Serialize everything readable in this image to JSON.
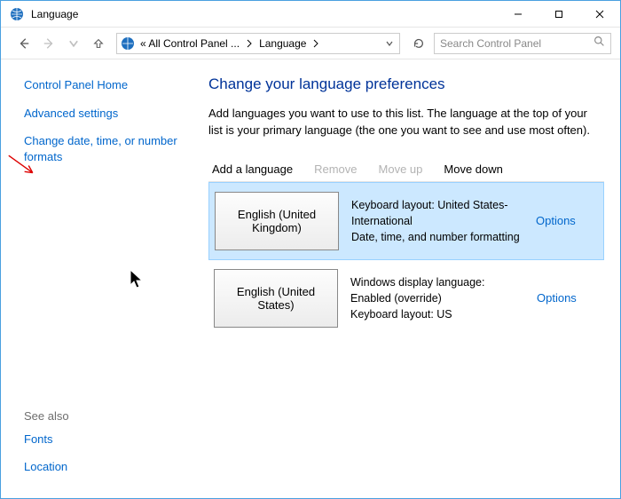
{
  "window": {
    "title": "Language"
  },
  "breadcrumb": {
    "part1": "« All Control Panel ...",
    "part2": "Language"
  },
  "search": {
    "placeholder": "Search Control Panel"
  },
  "sidebar": {
    "home": "Control Panel Home",
    "advanced": "Advanced settings",
    "dateformats": "Change date, time, or number formats",
    "seealso": "See also",
    "fonts": "Fonts",
    "location": "Location"
  },
  "main": {
    "heading": "Change your language preferences",
    "description": "Add languages you want to use to this list. The language at the top of your list is your primary language (the one you want to see and use most often).",
    "toolbar": {
      "add": "Add a language",
      "remove": "Remove",
      "moveup": "Move up",
      "movedown": "Move down"
    },
    "rows": [
      {
        "name": "English (United Kingdom)",
        "info": "Keyboard layout: United States-International\nDate, time, and number formatting",
        "options": "Options",
        "selected": true
      },
      {
        "name": "English (United States)",
        "info": "Windows display language: Enabled (override)\nKeyboard layout: US",
        "options": "Options",
        "selected": false
      }
    ]
  }
}
